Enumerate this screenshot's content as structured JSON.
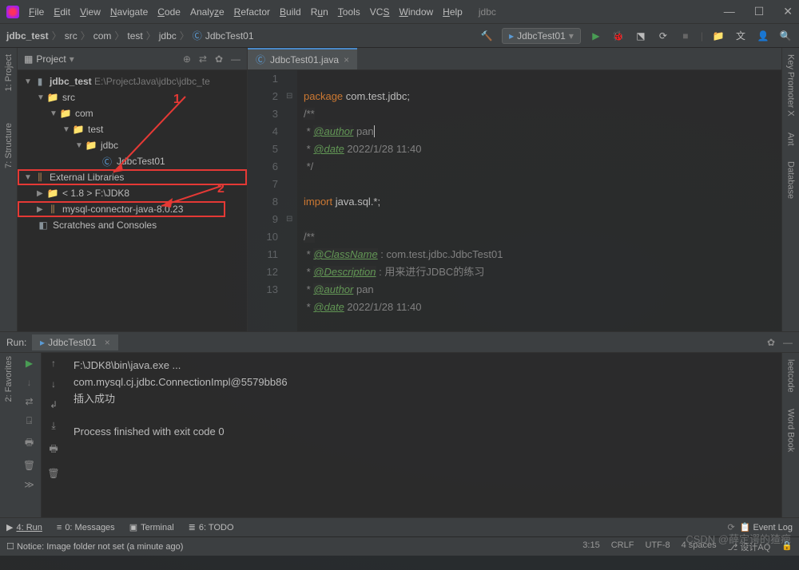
{
  "title": "jdbc",
  "menu": [
    "File",
    "Edit",
    "View",
    "Navigate",
    "Code",
    "Analyze",
    "Refactor",
    "Build",
    "Run",
    "Tools",
    "VCS",
    "Window",
    "Help"
  ],
  "breadcrumb": [
    "jdbc_test",
    "src",
    "com",
    "test",
    "jdbc",
    "JdbcTest01"
  ],
  "run_config": "JdbcTest01",
  "project_panel": {
    "title": "Project",
    "root": {
      "name": "jdbc_test",
      "path": "E:\\ProjectJava\\jdbc\\jdbc_te"
    },
    "src": "src",
    "com": "com",
    "test": "test",
    "jdbc": "jdbc",
    "class1": "JdbcTest01",
    "ext_lib": "External Libraries",
    "jdk": "< 1.8 >  F:\\JDK8",
    "mysql": "mysql-connector-java-8.0.23",
    "scratches": "Scratches and Consoles"
  },
  "annotations": {
    "a1": "1",
    "a2": "2"
  },
  "editor": {
    "tab": "JdbcTest01.java",
    "lines": {
      "l1": {
        "kw": "package ",
        "rest": "com.test.jdbc;"
      },
      "l2": "/**",
      "l3a": " * ",
      "l3tag": "@author",
      "l3b": " pan",
      "l4a": " * ",
      "l4tag": "@date",
      "l4b": " 2022/1/28 11:40",
      "l5": " */",
      "l7a": "import ",
      "l7b": "java.sql.*;",
      "l9": "/**",
      "l10a": " * ",
      "l10tag": "@ClassName",
      "l10b": " : com.test.jdbc.JdbcTest01",
      "l11a": " * ",
      "l11tag": "@Description",
      "l11b": " : 用来进行JDBC的练习",
      "l12a": " * ",
      "l12tag": "@author",
      "l12b": " pan",
      "l13a": " * ",
      "l13tag": "@date",
      "l13b": " 2022/1/28 11:40"
    }
  },
  "run": {
    "label": "Run:",
    "tab": "JdbcTest01",
    "out1": "F:\\JDK8\\bin\\java.exe ...",
    "out2": "com.mysql.cj.jdbc.ConnectionImpl@5579bb86",
    "out3": "插入成功",
    "out4": "Process finished with exit code 0"
  },
  "bottom": {
    "run": "4: Run",
    "msg": "0: Messages",
    "term": "Terminal",
    "todo": "6: TODO",
    "event": "Event Log"
  },
  "status": {
    "msg": "Notice: Image folder not set (a minute ago)",
    "pos": "3:15",
    "crlf": "CRLF",
    "enc": "UTF-8",
    "indent": "4 spaces",
    "branch": "设计AQ"
  },
  "right_tools": [
    "Key Promoter X",
    "Ant",
    "Database"
  ],
  "left_tools": [
    "1: Project",
    "7: Structure"
  ],
  "left_tools2": [
    "2: Favorites"
  ],
  "right_tools2": [
    "leetcode",
    "Word Book"
  ],
  "watermark": "CSDN @薛定谔的猹疤"
}
